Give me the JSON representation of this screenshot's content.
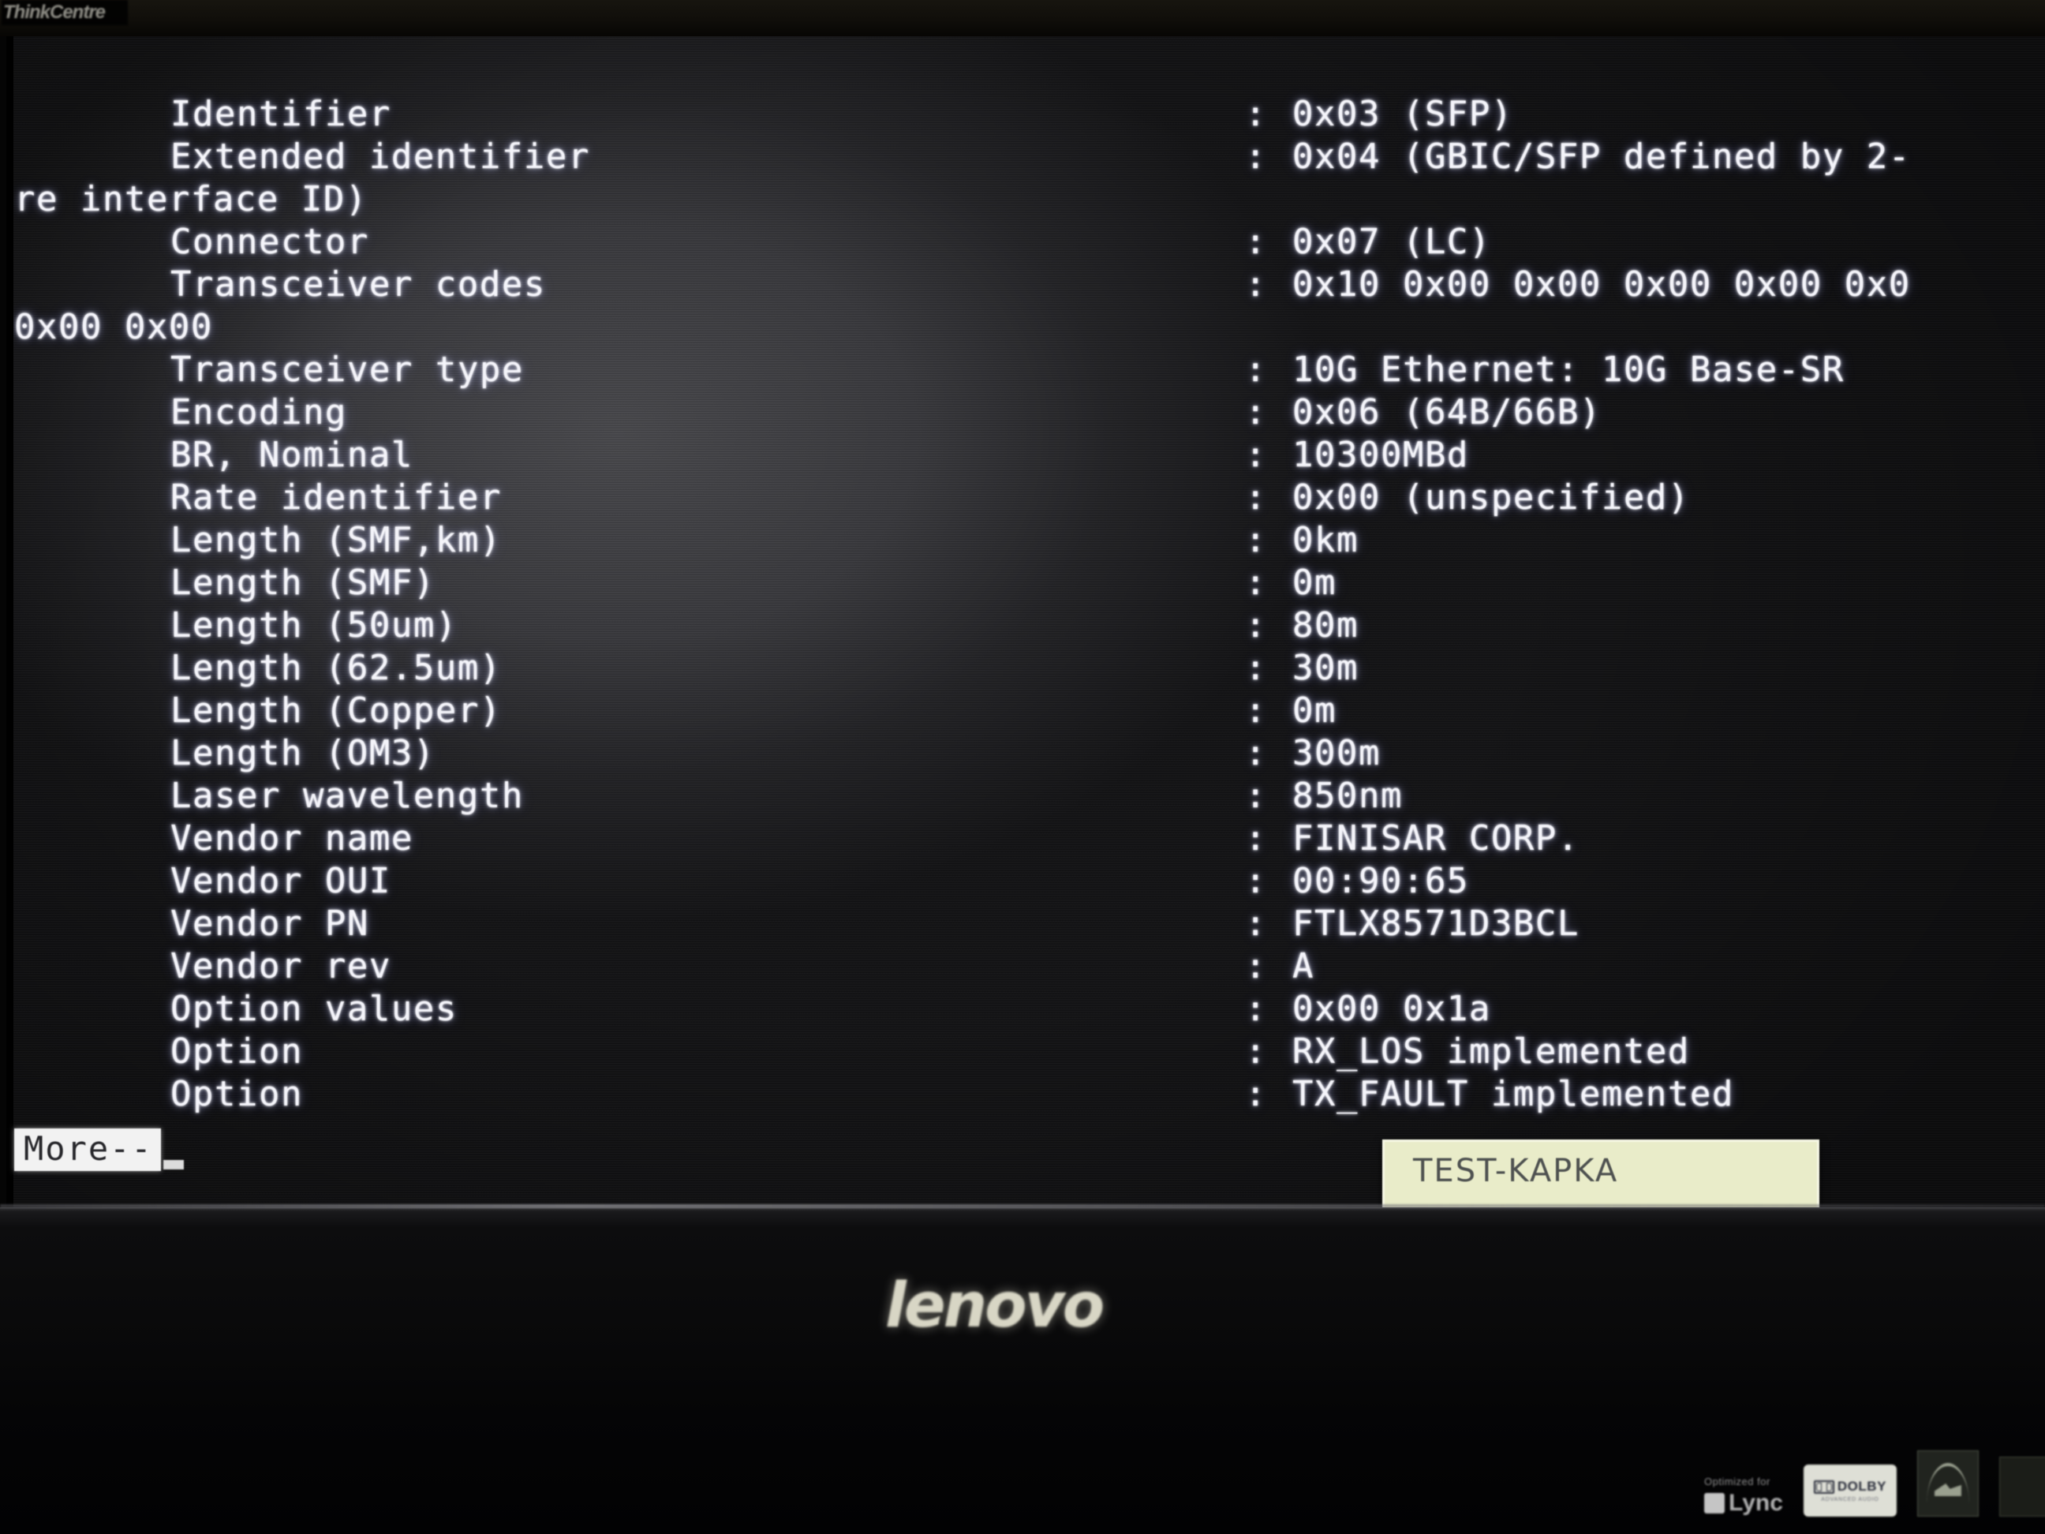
{
  "device": {
    "brand_logo": "lenovo",
    "bezel_badge": "ThinkCentre"
  },
  "screen": {
    "terminal": {
      "rows": [
        {
          "label": "Identifier",
          "colon": ":",
          "value": "0x03 (SFP)"
        },
        {
          "label": "Extended identifier",
          "colon": ":",
          "value": "0x04 (GBIC/SFP defined by 2-"
        },
        {
          "wrap": "re interface ID)"
        },
        {
          "label": "Connector",
          "colon": ":",
          "value": "0x07 (LC)"
        },
        {
          "label": "Transceiver codes",
          "colon": ":",
          "value": "0x10 0x00 0x00 0x00 0x00 0x0"
        },
        {
          "wrap": "0x00 0x00"
        },
        {
          "label": "Transceiver type",
          "colon": ":",
          "value": "10G Ethernet: 10G Base-SR"
        },
        {
          "label": "Encoding",
          "colon": ":",
          "value": "0x06 (64B/66B)"
        },
        {
          "label": "BR, Nominal",
          "colon": ":",
          "value": "10300MBd"
        },
        {
          "label": "Rate identifier",
          "colon": ":",
          "value": "0x00 (unspecified)"
        },
        {
          "label": "Length (SMF,km)",
          "colon": ":",
          "value": "0km"
        },
        {
          "label": "Length (SMF)",
          "colon": ":",
          "value": "0m"
        },
        {
          "label": "Length (50um)",
          "colon": ":",
          "value": "80m"
        },
        {
          "label": "Length (62.5um)",
          "colon": ":",
          "value": "30m"
        },
        {
          "label": "Length (Copper)",
          "colon": ":",
          "value": "0m"
        },
        {
          "label": "Length (OM3)",
          "colon": ":",
          "value": "300m"
        },
        {
          "label": "Laser wavelength",
          "colon": ":",
          "value": "850nm"
        },
        {
          "label": "Vendor name",
          "colon": ":",
          "value": "FINISAR CORP."
        },
        {
          "label": "Vendor OUI",
          "colon": ":",
          "value": "00:90:65"
        },
        {
          "label": "Vendor PN",
          "colon": ":",
          "value": "FTLX8571D3BCL"
        },
        {
          "label": "Vendor rev",
          "colon": ":",
          "value": "A"
        },
        {
          "label": "Option values",
          "colon": ":",
          "value": "0x00 0x1a"
        },
        {
          "label": "Option",
          "colon": ":",
          "value": "RX_LOS implemented"
        },
        {
          "label": "Option",
          "colon": ":",
          "value": "TX_FAULT implemented"
        }
      ]
    },
    "pager": {
      "prompt": "More--"
    },
    "osd": {
      "label": "TEST-KAPKA"
    }
  },
  "badges": {
    "lync_top": "Optimized for",
    "lync_main": "Lync",
    "dolby_word": "DOLBY",
    "dolby_sub": "ADVANCED AUDIO",
    "energy_star_name": "energy-star-logo"
  },
  "colors": {
    "terminal_text": "#f4f4fa",
    "osd_background": "#e9ecc9",
    "osd_text": "#4e5150",
    "pager_background": "#f2f2f2",
    "pager_text": "#26262a"
  }
}
